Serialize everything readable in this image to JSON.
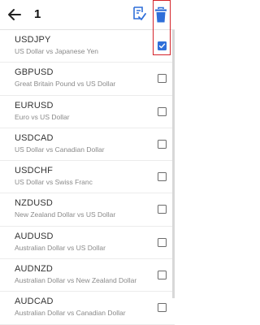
{
  "header": {
    "title": "1",
    "back_icon": "arrow-left-icon",
    "select_all_icon": "select-all-icon",
    "delete_icon": "trash-icon"
  },
  "colors": {
    "accent": "#2f6fd9",
    "highlight": "#d4232a"
  },
  "symbols": [
    {
      "symbol": "USDJPY",
      "description": "US Dollar vs Japanese Yen",
      "checked": true
    },
    {
      "symbol": "GBPUSD",
      "description": "Great Britain Pound vs US Dollar",
      "checked": false
    },
    {
      "symbol": "EURUSD",
      "description": "Euro vs US Dollar",
      "checked": false
    },
    {
      "symbol": "USDCAD",
      "description": "US Dollar vs Canadian Dollar",
      "checked": false
    },
    {
      "symbol": "USDCHF",
      "description": "US Dollar vs Swiss Franc",
      "checked": false
    },
    {
      "symbol": "NZDUSD",
      "description": "New Zealand Dollar vs US Dollar",
      "checked": false
    },
    {
      "symbol": "AUDUSD",
      "description": "Australian Dollar vs US Dollar",
      "checked": false
    },
    {
      "symbol": "AUDNZD",
      "description": "Australian Dollar vs New Zealand Dollar",
      "checked": false
    },
    {
      "symbol": "AUDCAD",
      "description": "Australian Dollar vs Canadian Dollar",
      "checked": false
    }
  ]
}
